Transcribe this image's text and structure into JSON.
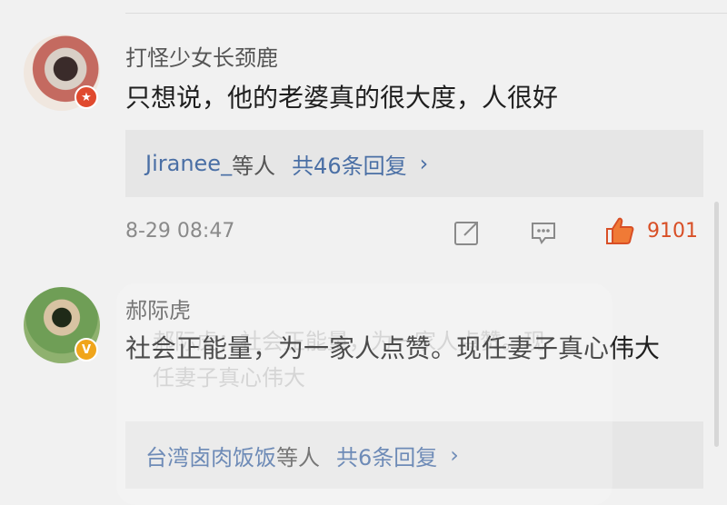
{
  "comments": [
    {
      "username": "打怪少女长颈鹿",
      "text": "只想说，他的老婆真的很大度，人很好",
      "replies": {
        "users": "Jiranee_",
        "suffix": "等人",
        "total": "共46条回复"
      },
      "timestamp": "8-29 08:47",
      "like_count": "9101",
      "badge_icon": "red-badge-icon"
    },
    {
      "username": "郝际虎",
      "text": "社会正能量，为一家人点赞。现任妻子真心伟大",
      "replies": {
        "users": "台湾卤肉饭饭",
        "suffix": "等人",
        "total": "共6条回复"
      },
      "badge_icon": "verified-v-icon"
    }
  ],
  "overlay": {
    "text": "郝际虎：社会正能量，为一家人点赞。现任妻子真心伟大"
  },
  "colors": {
    "link": "#4a6fa5",
    "like": "#d84f26",
    "background": "#f1f1f1"
  }
}
